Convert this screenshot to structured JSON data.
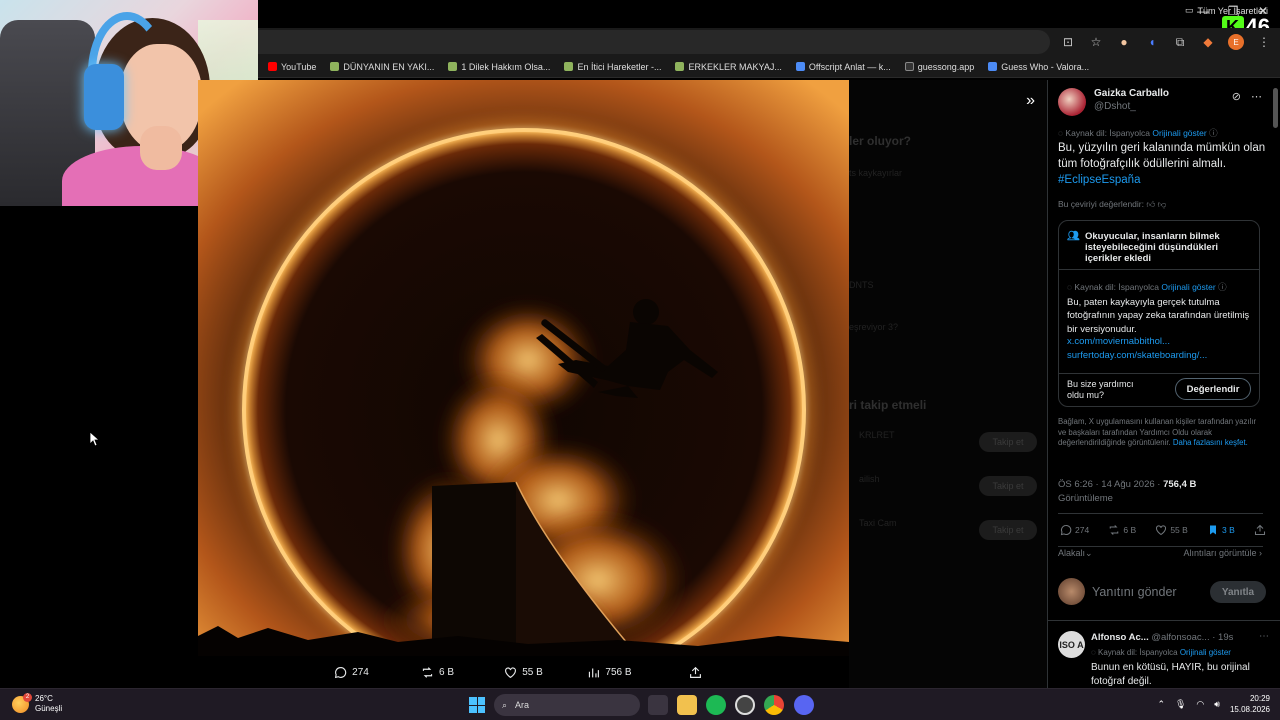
{
  "browser": {
    "bookmarks": [
      {
        "label": "YouTube",
        "icon": "youtube-icon"
      },
      {
        "label": "DÜNYANIN EN YAKI...",
        "icon": "folder-icon"
      },
      {
        "label": "1 Dilek Hakkım Olsa...",
        "icon": "folder-icon"
      },
      {
        "label": "En İtici Hareketler -...",
        "icon": "folder-icon"
      },
      {
        "label": "ERKEKLER MAKYAJ...",
        "icon": "folder-icon"
      },
      {
        "label": "Offscript Anlat — k...",
        "icon": "globe-icon"
      },
      {
        "label": "guessong.app",
        "icon": "g-icon"
      },
      {
        "label": "Guess Who - Valora...",
        "icon": "globe-icon"
      }
    ],
    "all_bookmarks_label": "Tüm Yer İşaretleri",
    "kick_viewer_count": "46"
  },
  "image_actions": {
    "replies": "274",
    "reposts": "6 B",
    "likes": "55 B",
    "views": "756 B"
  },
  "background_page": {
    "lines": [
      "ler oluyor?",
      "ts kaykayırlar",
      "DNTS",
      "eşreviyor 3?",
      "ri takip etmeli",
      "KRLRET",
      "ailish",
      "Taxi Cam"
    ],
    "follow_label": "Takip et"
  },
  "tweet": {
    "author_name": "Gaizka Carballo",
    "author_handle": "@Dshot_",
    "source_lang": "Kaynak dil: İspanyolca",
    "show_original": "Orijinali göster",
    "text": "Bu, yüzyılın geri kalanında mümkün olan tüm fotoğrafçılık ödüllerini almalı.",
    "hashtag": "#EclipseEspaña",
    "rate_translation": "Bu çeviriyi değerlendir:",
    "note": {
      "header": "Okuyucular, insanların bilmek isteyebileceğini düşündükleri içerikler ekledi",
      "source_lang": "Kaynak dil: İspanyolca",
      "show_original": "Orijinali göster",
      "text": "Bu, paten kaykayıyla gerçek tutulma fotoğrafının yapay zeka tarafından üretilmiş bir versiyonudur.",
      "link1": "x.com/moviernabbithol...",
      "link2": "surfertoday.com/skateboarding/...",
      "helpful_question": "Bu size yardımcı oldu mu?",
      "rate_button": "Değerlendir"
    },
    "note_footer": "Bağlam, X uygulamasını kullanan kişiler tarafından yazılır ve başkaları tarafından Yardımcı Oldu olarak değerlendirildiğinde görüntülenir.",
    "note_footer_link": "Daha fazlasını keşfet.",
    "timestamp": "ÖS 6:26 · 14 Ağu 2026 ·",
    "views_count": "756,4 B",
    "views_label": "Görüntüleme",
    "stats": {
      "replies": "274",
      "reposts": "6 B",
      "likes": "55 B",
      "bookmarks": "3 B"
    },
    "relevant_label": "Alakalı",
    "quotes_label": "Alıntıları görüntüle",
    "reply_placeholder": "Yanıtını gönder",
    "reply_button": "Yanıtla"
  },
  "comment": {
    "avatar_text": "ISO A",
    "author": "Alfonso Ac...",
    "handle": "@alfonsoac... · 19s",
    "source_lang": "Kaynak dil: İspanyolca",
    "show_original": "Orijinali göster",
    "text": "Bunun en kötüsü, HAYIR, bu orijinal fotoğraf değil."
  },
  "taskbar": {
    "temperature": "26°C",
    "weather": "Güneşli",
    "weather_badge": "2",
    "search_placeholder": "Ara",
    "time": "20:29",
    "date": "15.08.2026"
  },
  "colors": {
    "accent_blue": "#1d9bf0",
    "kick_green": "#53fc18",
    "eclipse_orange": "#f28c28"
  }
}
